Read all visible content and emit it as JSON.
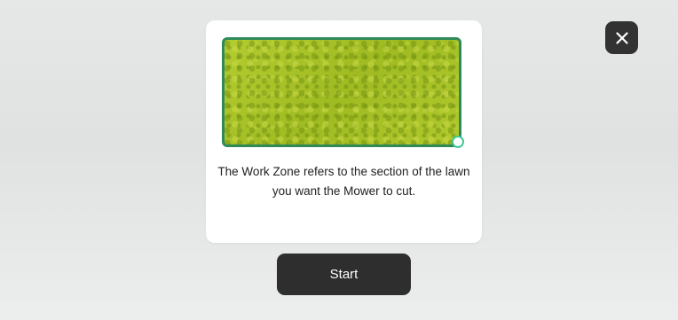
{
  "dialog": {
    "close_icon": "close-icon",
    "illustration": {
      "name": "work-zone-lawn",
      "fill_color": "#a8c22a",
      "border_color": "#2f8a5a",
      "handle_color": "#3fc99a"
    },
    "description": "The Work Zone refers to the section of the lawn you want the Mower to cut."
  },
  "actions": {
    "start_label": "Start"
  },
  "colors": {
    "button_background": "#2e2e2e",
    "card_background": "#ffffff"
  }
}
